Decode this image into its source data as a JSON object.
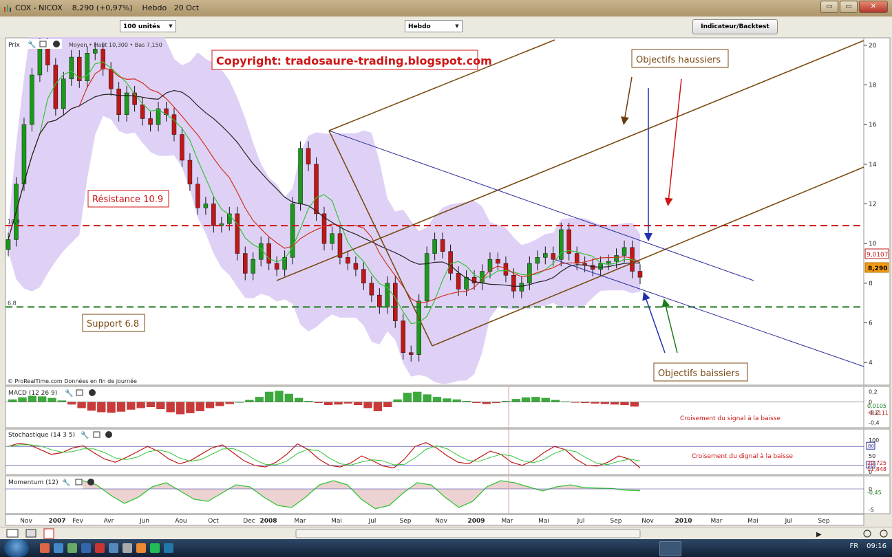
{
  "window": {
    "title": "COX - NICOX    8,290 (+0,97%)    Hebdo   20 Oct",
    "minimize": "▭",
    "restore": "▭",
    "close": "✕"
  },
  "toolbar": {
    "units_select": "100 unités",
    "period_select": "Hebdo",
    "indicator_button": "Indicateur/Backtest"
  },
  "colors": {
    "candle_up": "#1a9a1a",
    "candle_down": "#c01717",
    "bollinger_fill": "#dcccf5",
    "resistance": "#d01515",
    "support": "#1a7a1a",
    "trendline_brown": "#7a4a12",
    "trendline_blue": "#2b2f9a",
    "ma_fast": "#33c433",
    "ma_mid": "#d0301a",
    "ma_slow": "#222222"
  },
  "chart_data": [
    {
      "type": "candlestick",
      "panel": "Prix",
      "title": "Prix",
      "legend_text": "Moyen  • Haut 10,300 • Bas 7,150",
      "ylim": [
        3,
        20.2
      ],
      "y_ticks": [
        "20",
        "18",
        "16",
        "14",
        "12",
        "10",
        "8",
        "6",
        "4"
      ],
      "x_tick_labels": [
        "Nov",
        "2007",
        "Fev",
        "Avr",
        "Jun",
        "Aou",
        "Oct",
        "Dec",
        "2008",
        "Mar",
        "Mai",
        "Jul",
        "Sep",
        "Nov",
        "2009",
        "Mar",
        "Mai",
        "Jul",
        "Sep",
        "Nov",
        "2010",
        "Mar",
        "Mai",
        "Jul",
        "Sep"
      ],
      "last_price_label": "8,290",
      "ma_label": "9,0107",
      "resistance": {
        "value": 10.9,
        "label": "10,9",
        "annotation": "Résistance 10.9"
      },
      "support": {
        "value": 6.8,
        "label": "6,8",
        "annotation": "Support 6.8"
      },
      "close_series": [
        10.2,
        13.0,
        16.0,
        18.5,
        20.0,
        19.0,
        16.8,
        18.3,
        19.4,
        18.2,
        19.6,
        19.8,
        18.8,
        17.8,
        16.5,
        17.6,
        17.0,
        16.3,
        16.0,
        16.8,
        16.5,
        15.5,
        14.2,
        13.0,
        11.8,
        12.0,
        10.9,
        11.0,
        11.5,
        9.5,
        8.5,
        9.2,
        10.0,
        9.0,
        8.7,
        9.3,
        12.0,
        14.8,
        14.0,
        11.5,
        10.0,
        10.5,
        9.3,
        9.0,
        8.7,
        8.0,
        7.4,
        6.8,
        8.0,
        6.1,
        4.5,
        4.4,
        7.1,
        9.5,
        10.2,
        9.6,
        8.5,
        7.7,
        8.3,
        8.0,
        8.6,
        9.2,
        9.0,
        8.4,
        7.6,
        8.0,
        9.0,
        9.3,
        9.5,
        9.2,
        10.7,
        9.5,
        9.0,
        8.9,
        8.7,
        9.0,
        9.1,
        9.4,
        9.8,
        8.6,
        8.3
      ],
      "annotations": [
        {
          "text": "Copyright: tradosaure-trading.blogspot.com"
        },
        {
          "text": "Objectifs haussiers"
        },
        {
          "text": "Objectifs baissiers"
        }
      ],
      "source_text": "© ProRealTime.com  Données en fin de journée"
    },
    {
      "type": "histogram",
      "panel": "MACD",
      "title": "MACD (12 26 9)",
      "ylim": [
        -0.45,
        0.25
      ],
      "y_ticks": [
        "0,2",
        "0",
        "-0,2",
        "-0,4"
      ],
      "value_labels": [
        "0,0105",
        "-0,1111"
      ],
      "annotation": "Croisement du signal à la baisse",
      "values": [
        0.05,
        0.09,
        0.12,
        0.11,
        0.08,
        0.03,
        -0.05,
        -0.12,
        -0.17,
        -0.2,
        -0.21,
        -0.19,
        -0.15,
        -0.12,
        -0.1,
        -0.14,
        -0.2,
        -0.24,
        -0.22,
        -0.18,
        -0.12,
        -0.08,
        -0.04,
        0.0,
        0.04,
        0.1,
        0.2,
        0.22,
        0.16,
        0.08,
        0.02,
        -0.02,
        -0.06,
        -0.05,
        -0.03,
        -0.06,
        -0.12,
        -0.18,
        -0.1,
        0.05,
        0.18,
        0.2,
        0.15,
        0.1,
        0.07,
        0.05,
        0.02,
        -0.02,
        -0.04,
        -0.02,
        0.02,
        0.06,
        0.09,
        0.1,
        0.08,
        0.04,
        0.01,
        -0.01,
        -0.02,
        -0.03,
        -0.04,
        -0.05,
        -0.06,
        -0.09
      ]
    },
    {
      "type": "line",
      "panel": "Stochastique",
      "title": "Stochastique (14 3 5)",
      "ylim": [
        0,
        100
      ],
      "y_ticks": [
        "100",
        "50",
        "0"
      ],
      "level_labels": [
        "80",
        "20"
      ],
      "value_labels": [
        "20,725",
        "11,848"
      ],
      "annotation": "Croisement du dignal à la baisse",
      "values": [
        80,
        90,
        85,
        70,
        55,
        60,
        75,
        82,
        60,
        40,
        30,
        45,
        62,
        80,
        65,
        40,
        25,
        35,
        55,
        75,
        85,
        60,
        35,
        20,
        15,
        30,
        55,
        88,
        70,
        40,
        20,
        15,
        28,
        50,
        35,
        18,
        12,
        40,
        80,
        92,
        75,
        50,
        30,
        25,
        45,
        65,
        55,
        30,
        20,
        35,
        60,
        80,
        70,
        40,
        20,
        18,
        30,
        50,
        40,
        12
      ]
    },
    {
      "type": "area",
      "panel": "Momentum",
      "title": "Momentum (12)",
      "ylim": [
        -5.5,
        2.5
      ],
      "y_ticks": [
        "0",
        "-5"
      ],
      "value_labels": [
        "-0,45"
      ],
      "values": [
        2.0,
        1.0,
        -1.5,
        -3.5,
        -2.0,
        0.5,
        1.5,
        -0.5,
        -2.5,
        -3.0,
        -1.0,
        1.0,
        0.5,
        -2.0,
        -4.0,
        -4.5,
        -2.0,
        1.0,
        2.0,
        1.0,
        -2.5,
        -4.8,
        -4.0,
        -1.0,
        1.5,
        1.0,
        -2.0,
        -4.5,
        -3.0,
        0.5,
        2.0,
        1.5,
        0.5,
        -0.5,
        0.5,
        1.0,
        0.3,
        0.2,
        0.1,
        -0.3,
        -0.45
      ]
    }
  ],
  "bottombar": {
    "icons": [
      "mail-icon",
      "print-icon",
      "close-icon"
    ]
  },
  "taskbar": {
    "lang": "FR",
    "clock": "09:16"
  }
}
